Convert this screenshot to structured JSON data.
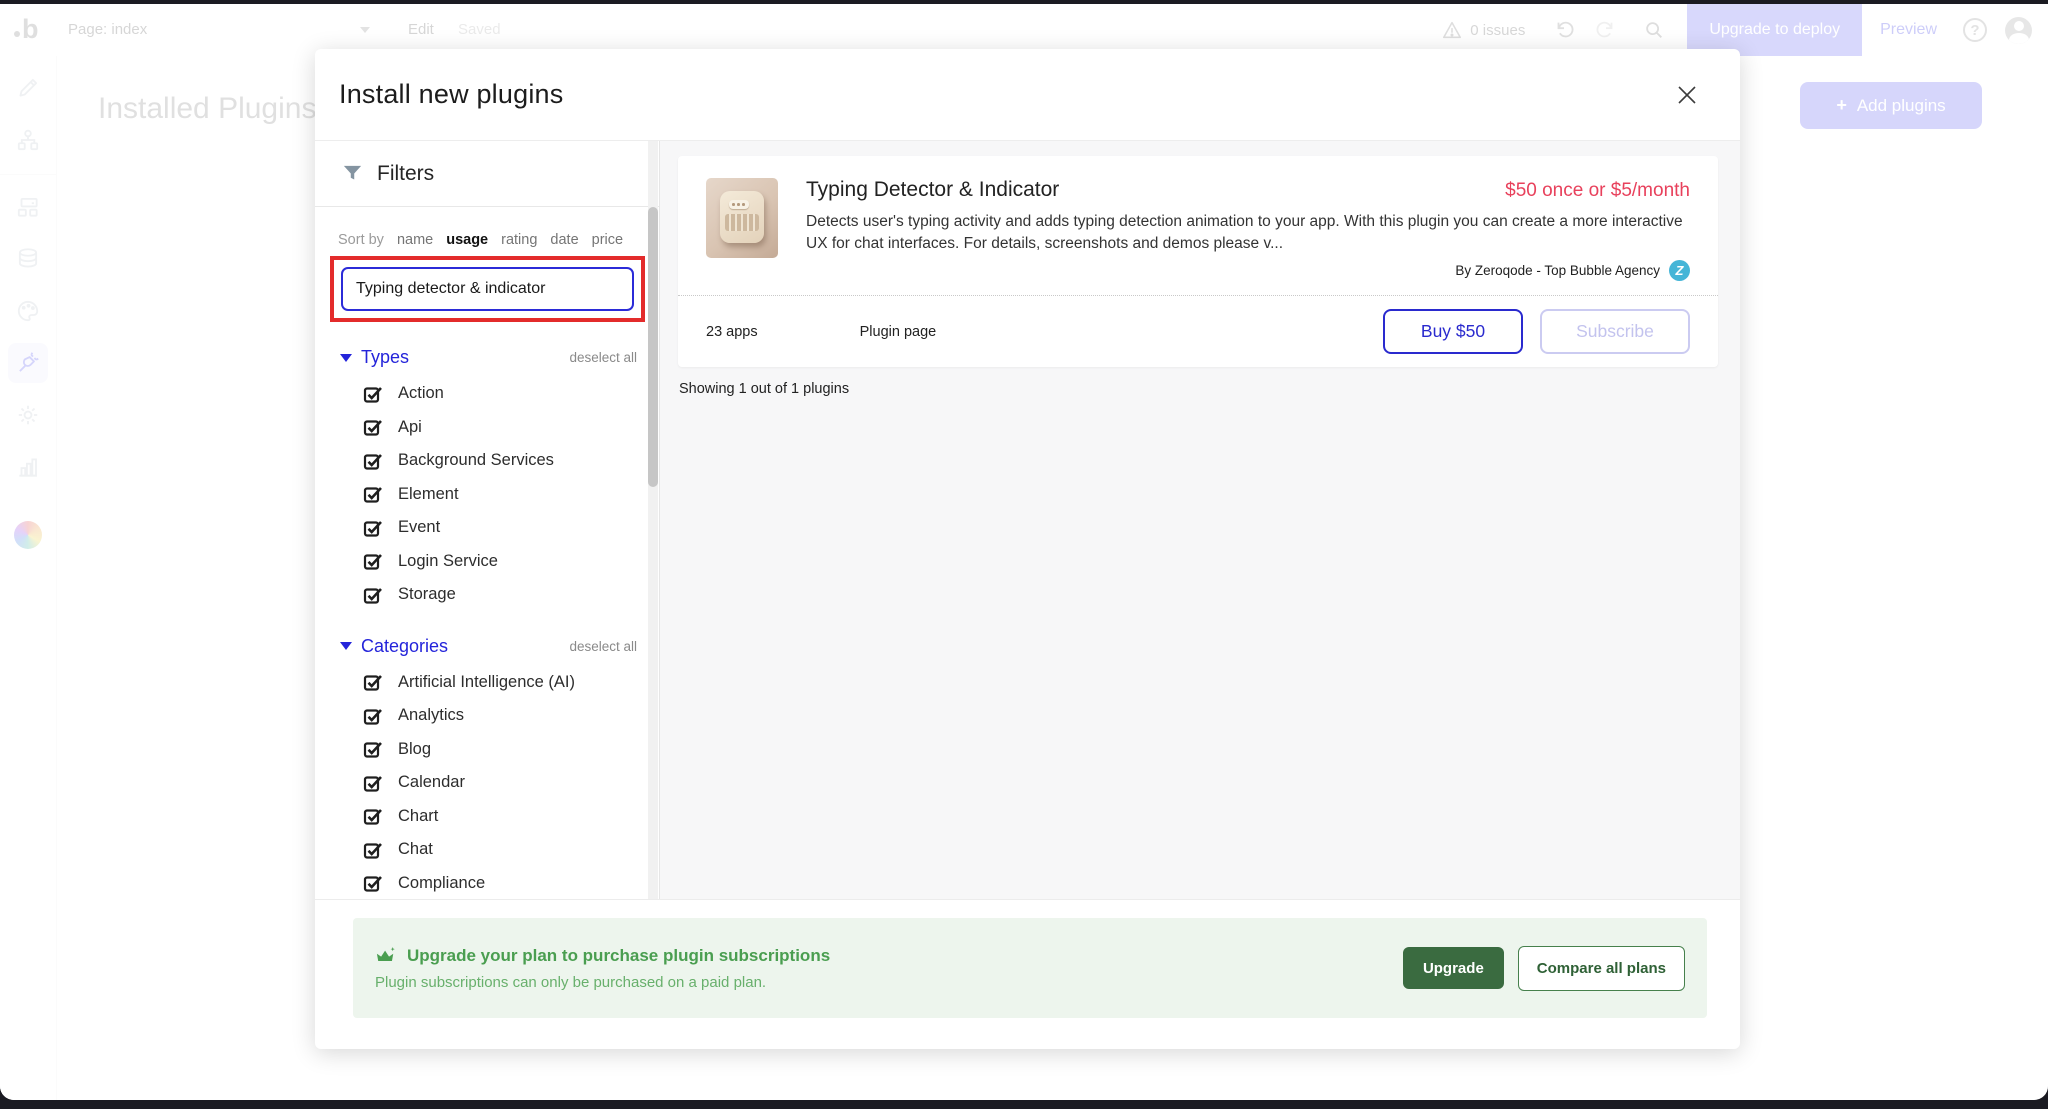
{
  "toolbar": {
    "page_label": "Page: index",
    "edit_label": "Edit",
    "saved_label": "Saved",
    "issues_label": "0 issues",
    "deploy_button": "Upgrade to deploy",
    "preview_label": "Preview",
    "help_label": "?"
  },
  "sidebar": {
    "icons": [
      "design",
      "workflow",
      "components",
      "data",
      "styles",
      "plugins",
      "settings",
      "logs",
      "agency-logo"
    ],
    "active_icon": "plugins"
  },
  "background": {
    "page_title": "Installed Plugins",
    "add_plugins_button": "Add plugins",
    "plus_glyph": "+"
  },
  "modal": {
    "title": "Install new plugins",
    "filters": {
      "title": "Filters",
      "sort_label": "Sort by",
      "sort_options": [
        {
          "label": "name",
          "active": false
        },
        {
          "label": "usage",
          "active": true
        },
        {
          "label": "rating",
          "active": false
        },
        {
          "label": "date",
          "active": false
        },
        {
          "label": "price",
          "active": false
        }
      ],
      "search_value": "Typing detector & indicator",
      "types": {
        "title": "Types",
        "deselect_label": "deselect all",
        "items": [
          "Action",
          "Api",
          "Background Services",
          "Element",
          "Event",
          "Login Service",
          "Storage"
        ]
      },
      "categories": {
        "title": "Categories",
        "deselect_label": "deselect all",
        "items": [
          "Artificial Intelligence (AI)",
          "Analytics",
          "Blog",
          "Calendar",
          "Chart",
          "Chat",
          "Compliance"
        ]
      }
    },
    "plugin": {
      "name": "Typing Detector & Indicator",
      "price": "$50 once or $5/month",
      "description": "Detects user's typing activity and adds typing detection animation to your app. With this plugin you can create a more interactive UX for chat interfaces. For details, screenshots and demos please v...",
      "byline": "By Zeroqode - Top Bubble Agency",
      "badge_letter": "Z",
      "apps_count": "23 apps",
      "page_link": "Plugin page",
      "buy_button": "Buy $50",
      "subscribe_button": "Subscribe"
    },
    "results_summary": "Showing 1 out of 1 plugins",
    "banner": {
      "title": "Upgrade your plan to purchase plugin subscriptions",
      "subtitle": "Plugin subscriptions can only be purchased on a paid plan.",
      "upgrade_button": "Upgrade",
      "compare_button": "Compare all plans"
    }
  },
  "colors": {
    "accent_blue": "#2a2ace",
    "link_purple": "#4d4de8",
    "price_red": "#e8415c",
    "annotation_red": "#e32b2b",
    "green_title": "#4a9e50",
    "green_button": "#3a6b40",
    "badge_blue": "#45b5d7",
    "lavender_button": "#7474f2"
  }
}
